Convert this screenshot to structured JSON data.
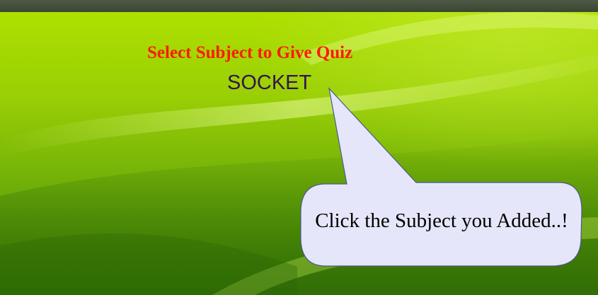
{
  "quiz": {
    "heading": "Select Subject to Give Quiz",
    "subjects": [
      "SOCKET"
    ]
  },
  "tooltip": {
    "text": "Click the Subject you Added..!"
  },
  "colors": {
    "heading": "#ff1a00",
    "subject_link": "#33134f",
    "callout_fill": "#e6e6fa",
    "callout_border": "#4a5a8a",
    "background": "#99cf05"
  }
}
